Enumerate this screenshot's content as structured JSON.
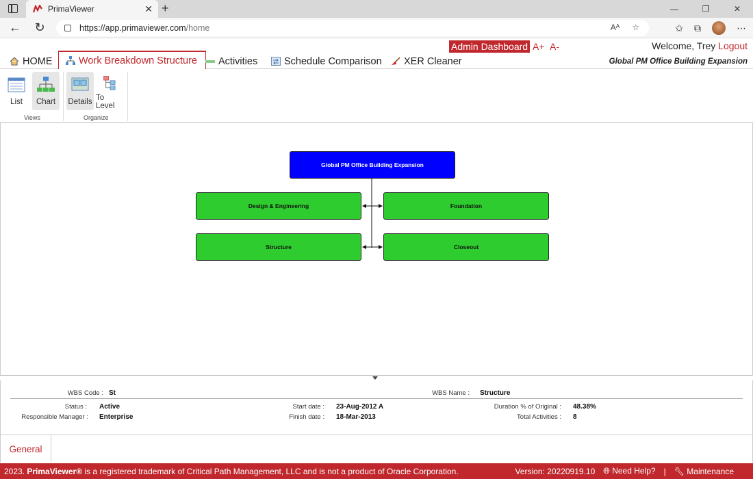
{
  "browser": {
    "tab_title": "PrimaViewer",
    "url_host": "https://app.primaviewer.com",
    "url_path": "/home"
  },
  "header": {
    "tabs": [
      {
        "label": "HOME",
        "icon": "house-icon"
      },
      {
        "label": "Work Breakdown Structure",
        "icon": "hierarchy-icon"
      },
      {
        "label": "Activities",
        "icon": "bar-icon"
      },
      {
        "label": "Schedule Comparison",
        "icon": "compare-icon"
      },
      {
        "label": "XER Cleaner",
        "icon": "broom-icon"
      }
    ],
    "admin_label": "Admin Dashboard",
    "font_increase": "A+",
    "font_decrease": "A-",
    "welcome": "Welcome, Trey",
    "logout": "Logout",
    "project_title": "Global PM Office Building Expansion"
  },
  "ribbon": {
    "views": {
      "label": "Views",
      "list": "List",
      "chart": "Chart"
    },
    "organize": {
      "label": "Organize",
      "details": "Details",
      "to_level": "To Level"
    }
  },
  "wbs": {
    "root": "Global PM Office Building Expansion",
    "children": [
      "Design & Engineering",
      "Foundation",
      "Structure",
      "Closeout"
    ]
  },
  "details": {
    "wbs_code_label": "WBS Code :",
    "wbs_code": "St",
    "wbs_name_label": "WBS Name :",
    "wbs_name": "Structure",
    "status_label": "Status :",
    "status": "Active",
    "manager_label": "Responsible Manager :",
    "manager": "Enterprise",
    "start_label": "Start date :",
    "start": "23-Aug-2012 A",
    "finish_label": "Finish date :",
    "finish": "18-Mar-2013",
    "duration_label": "Duration % of Original :",
    "duration": "48.38%",
    "total_label": "Total Activities :",
    "total": "8",
    "tab_general": "General"
  },
  "footer": {
    "prefix": "2023.",
    "brand": "PrimaViewer®",
    "text": "is a registered trademark of Critical Path Management, LLC and is not a product of Oracle Corporation.",
    "version": "Version: 20220919.10",
    "help": "Need Help?",
    "separator": "|",
    "maintenance": "Maintenance"
  },
  "colors": {
    "accent": "#c0282d",
    "root_node": "#0000ff",
    "child_node": "#2ecc2e"
  }
}
